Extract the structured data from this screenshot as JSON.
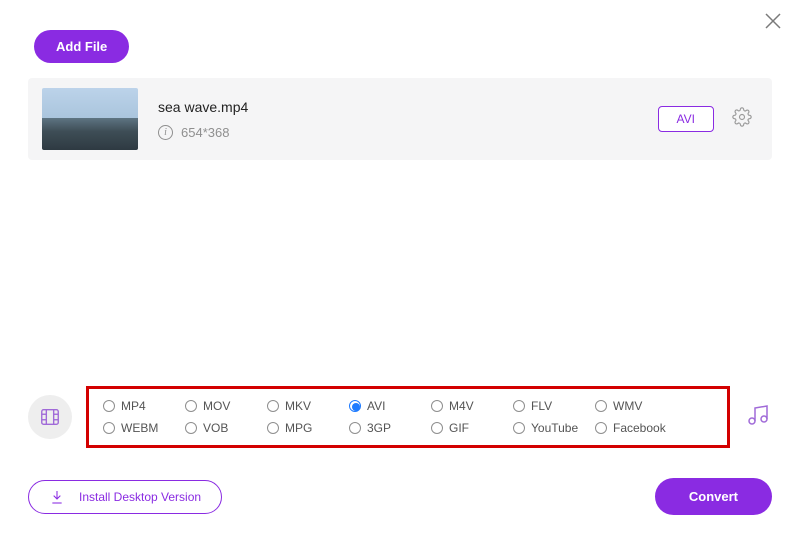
{
  "buttons": {
    "add_file": "Add File",
    "install": "Install Desktop Version",
    "convert": "Convert"
  },
  "file": {
    "name": "sea wave.mp4",
    "dimensions": "654*368",
    "output_format": "AVI"
  },
  "formats": {
    "selected": "AVI",
    "row1": [
      "MP4",
      "MOV",
      "MKV",
      "AVI",
      "M4V",
      "FLV",
      "WMV"
    ],
    "row2": [
      "WEBM",
      "VOB",
      "MPG",
      "3GP",
      "GIF",
      "YouTube",
      "Facebook"
    ]
  },
  "icons": {
    "close": "close-icon",
    "info": "info-icon",
    "gear": "gear-icon",
    "film": "filmstrip-icon",
    "music": "music-icon",
    "download": "download-icon"
  }
}
